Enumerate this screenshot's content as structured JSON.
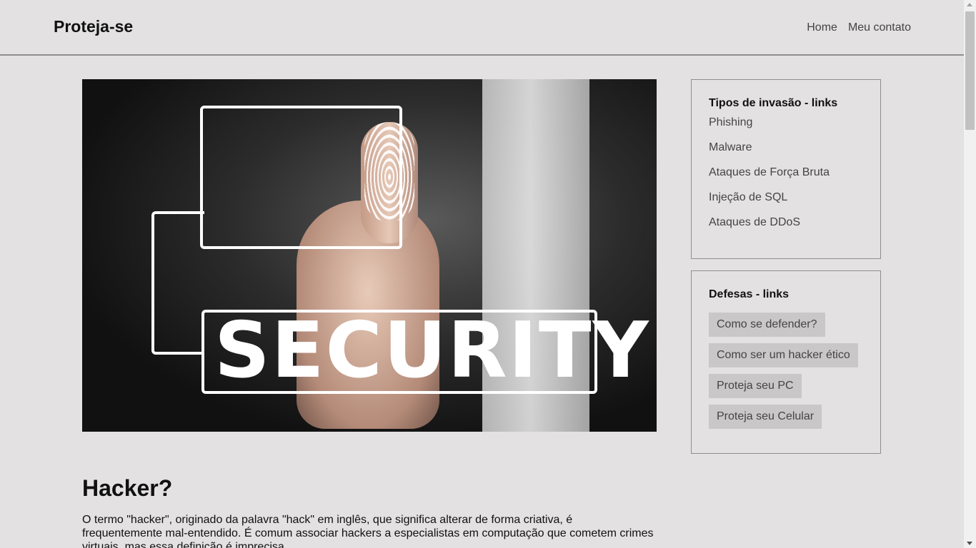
{
  "header": {
    "brand": "Proteja-se",
    "nav": [
      "Home",
      "Meu contato"
    ]
  },
  "hero": {
    "image_text": "SECURITY",
    "icon": "fingerprint-icon"
  },
  "article": {
    "title": "Hacker?",
    "paragraph": "O termo \"hacker\", originado da palavra \"hack\" em inglês, que significa alterar de forma criativa, é frequentemente mal-entendido. É comum associar hackers a especialistas em computação que cometem crimes virtuais, mas essa definição é imprecisa."
  },
  "sidebar": {
    "invasion": {
      "title": "Tipos de invasão - links",
      "links": [
        "Phishing",
        "Malware",
        "Ataques de Força Bruta",
        "Injeção de SQL",
        "Ataques de DDoS"
      ]
    },
    "defenses": {
      "title": "Defesas - links",
      "buttons": [
        "Como se defender?",
        "Como ser um hacker ético",
        "Proteja seu PC",
        "Proteja seu Celular"
      ]
    }
  },
  "colors": {
    "background": "#e3e1e2",
    "button_bg": "#c9c7c8",
    "border": "#8f8f8f"
  }
}
